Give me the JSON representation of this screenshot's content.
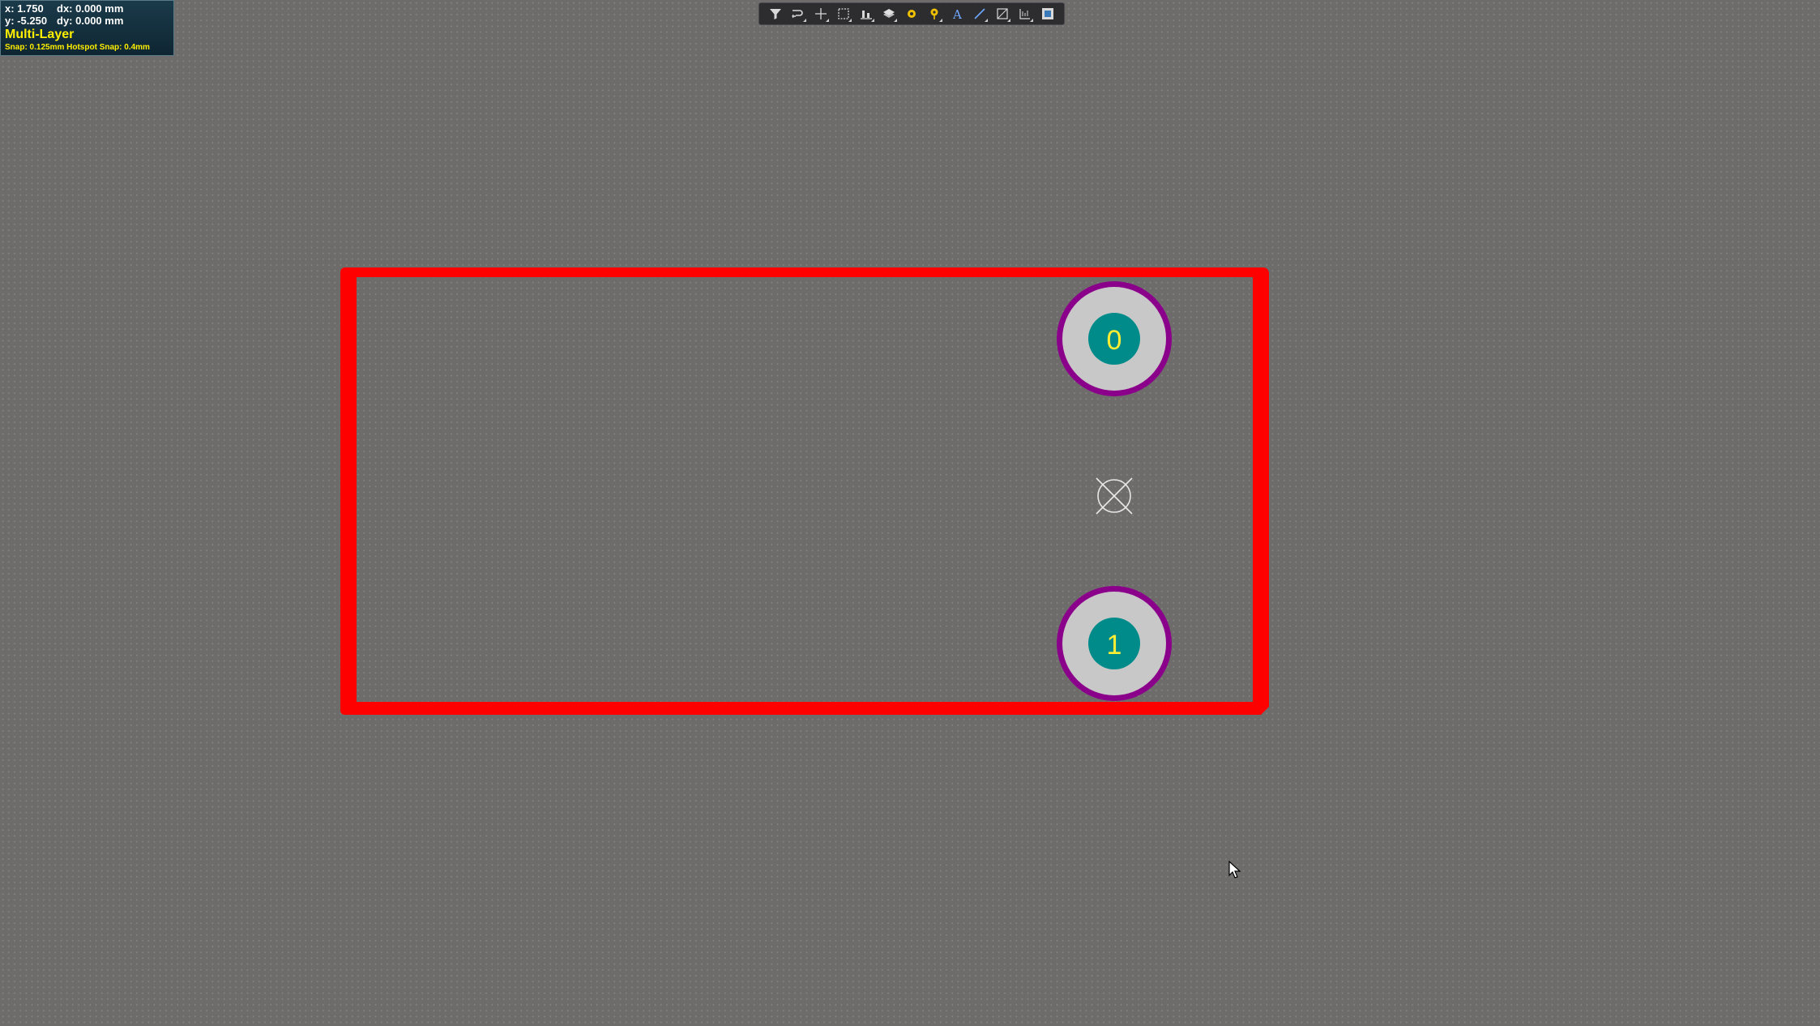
{
  "hud": {
    "x_label": "x:",
    "x_value": "1.750",
    "dx_label": "dx:",
    "dx_value": "0.000 mm",
    "y_label": "y:",
    "y_value": "-5.250",
    "dy_label": "dy:",
    "dy_value": "0.000 mm",
    "layer": "Multi-Layer",
    "snap": "Snap: 0.125mm Hotspot Snap: 0.4mm"
  },
  "toolbar": {
    "items": [
      {
        "icon": "filter-icon"
      },
      {
        "icon": "route-icon"
      },
      {
        "icon": "crosshair-icon"
      },
      {
        "icon": "select-rect-icon"
      },
      {
        "icon": "align-icon"
      },
      {
        "icon": "layers-icon"
      },
      {
        "icon": "pad-icon"
      },
      {
        "icon": "via-icon"
      },
      {
        "icon": "text-icon"
      },
      {
        "icon": "line-icon"
      },
      {
        "icon": "region-icon"
      },
      {
        "icon": "dimension-icon"
      },
      {
        "icon": "board-shape-icon"
      }
    ]
  },
  "footprint": {
    "pads": [
      {
        "designator": "0"
      },
      {
        "designator": "1"
      }
    ],
    "colors": {
      "outline": "#ff0000",
      "pad_ring": "#8b008b",
      "pad_copper": "#c8c8c8",
      "pad_hole": "#008b8b",
      "label": "#ffee33",
      "background": "#6e6b6b"
    }
  }
}
